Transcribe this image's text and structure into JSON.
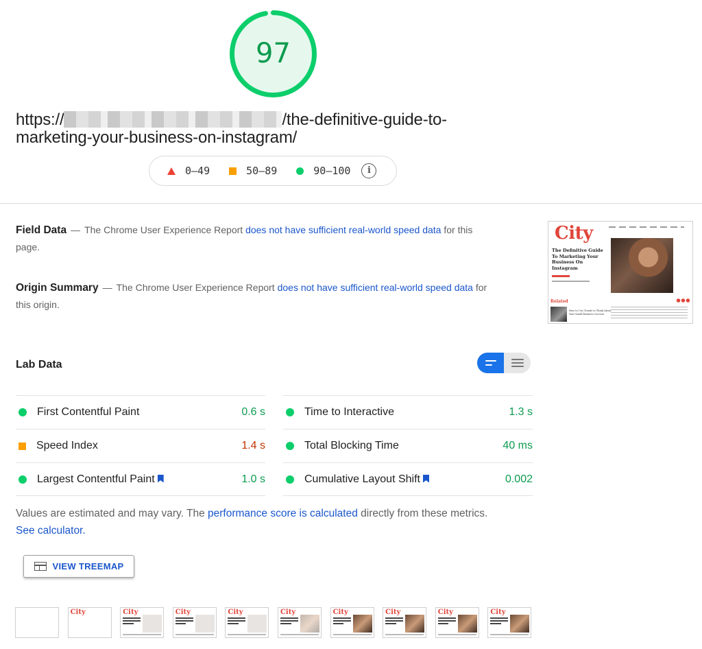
{
  "score": {
    "value": "97",
    "fraction": 0.97,
    "color": "#0cce6b"
  },
  "url": {
    "prefix": "https://",
    "suffix": "/the-definitive-guide-to-",
    "line2": "marketing-your-business-on-instagram/"
  },
  "legend": {
    "fail": "0–49",
    "average": "50–89",
    "pass": "90–100",
    "info_icon": "info-icon"
  },
  "field_data": {
    "title": "Field Data",
    "dash": "—",
    "text_before": "The Chrome User Experience Report",
    "link": "does not have sufficient real-world speed data",
    "text_after": "for this page."
  },
  "origin_summary": {
    "title": "Origin Summary",
    "dash": "—",
    "text_before": "The Chrome User Experience Report",
    "link": "does not have sufficient real-world speed data",
    "text_after": "for this origin."
  },
  "thumbnail": {
    "logo": "City",
    "headline": "The Definitive Guide To Marketing Your Business On Instagram",
    "related": "Related",
    "related_item": "How to Use Trends to Think About Your Small Business Success"
  },
  "lab_data": {
    "title": "Lab Data",
    "left": [
      {
        "name": "First Contentful Paint",
        "value": "0.6 s",
        "status": "pass"
      },
      {
        "name": "Speed Index",
        "value": "1.4 s",
        "status": "average"
      },
      {
        "name": "Largest Contentful Paint",
        "value": "1.0 s",
        "status": "pass"
      }
    ],
    "right": [
      {
        "name": "Time to Interactive",
        "value": "1.3 s",
        "status": "pass"
      },
      {
        "name": "Total Blocking Time",
        "value": "40 ms",
        "status": "pass"
      },
      {
        "name": "Cumulative Layout Shift",
        "value": "0.002",
        "status": "pass"
      }
    ]
  },
  "note": {
    "text1": "Values are estimated and may vary. The",
    "link1": "performance score is calculated",
    "text2": "directly from these metrics.",
    "link2": "See calculator."
  },
  "treemap_button": "VIEW TREEMAP",
  "filmstrip_logo": "City",
  "colors": {
    "pass": "#0cce6b",
    "average": "#fa9f00",
    "fail": "#eb4335",
    "link": "#1a56cc"
  }
}
